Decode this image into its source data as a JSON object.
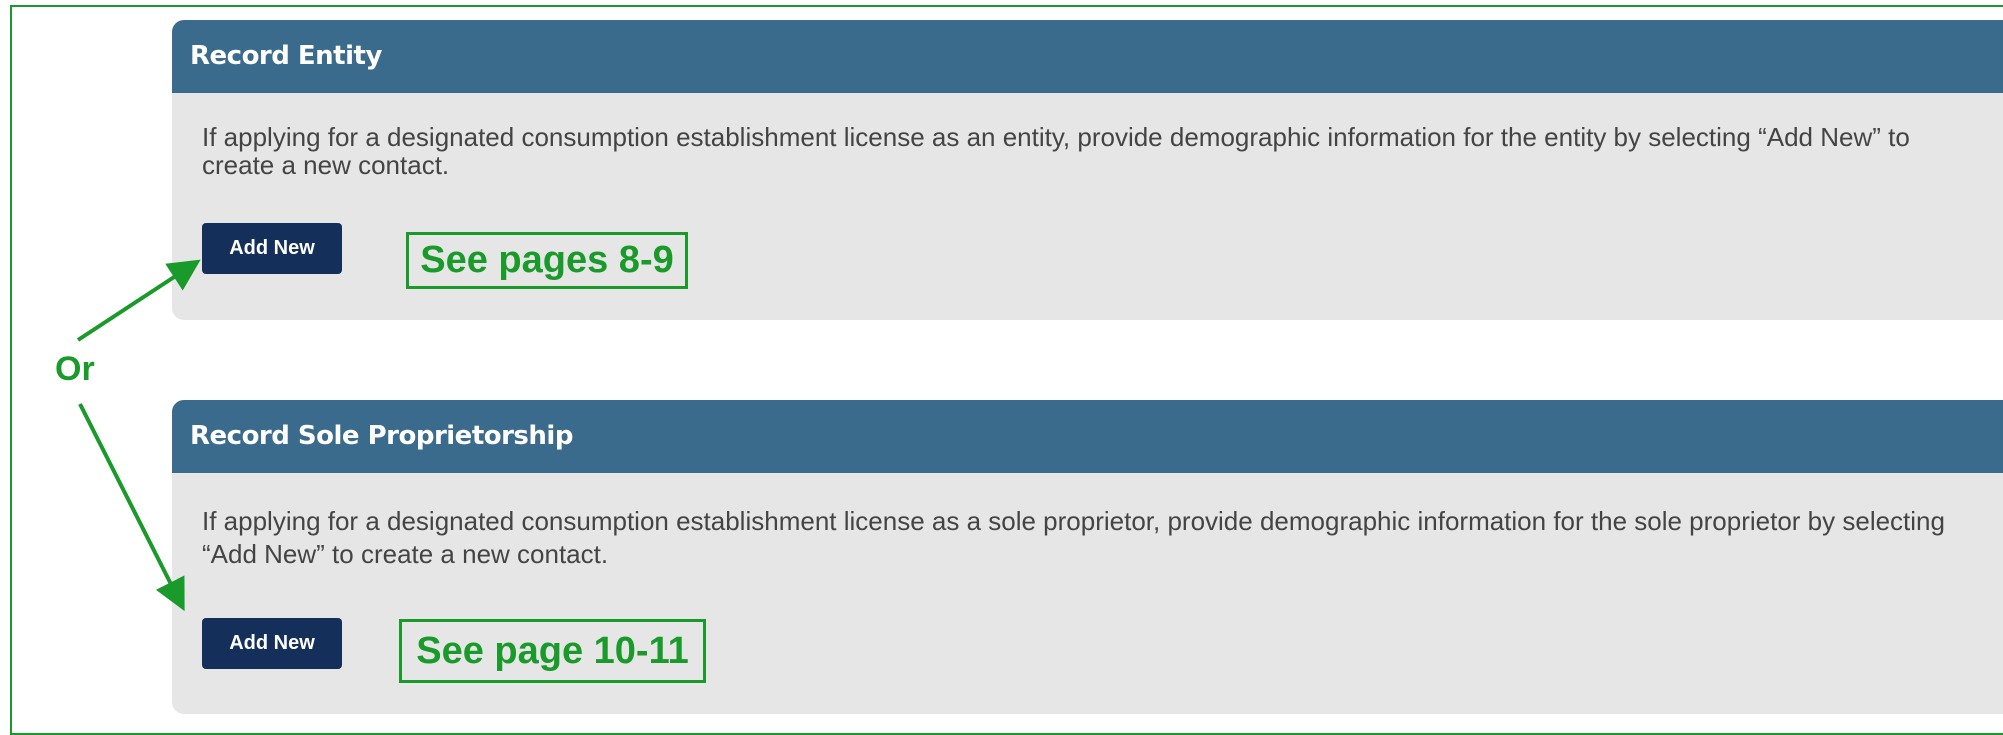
{
  "entity_panel": {
    "title": "Record Entity",
    "description": "If applying for a designated consumption establishment license as an entity, provide demographic information for the entity by selecting “Add New” to create a new contact.",
    "button_label": "Add New",
    "callout": "See pages 8-9"
  },
  "sole_panel": {
    "title": "Record Sole Proprietorship",
    "description": "If applying for a designated consumption establishment license as a sole proprietor, provide demographic information for the sole proprietor by selecting “Add New” to create a new contact.",
    "button_label": "Add New",
    "callout": "See page 10-11"
  },
  "annotation": {
    "or_label": "Or",
    "color": "#1a9a2a"
  },
  "colors": {
    "header": "#3b6b8c",
    "panel_bg": "#e6e6e6",
    "button": "#14305a"
  }
}
